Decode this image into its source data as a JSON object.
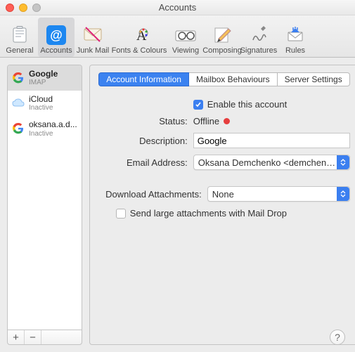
{
  "window": {
    "title": "Accounts"
  },
  "toolbar": {
    "items": [
      {
        "label": "General"
      },
      {
        "label": "Accounts"
      },
      {
        "label": "Junk Mail"
      },
      {
        "label": "Fonts & Colours"
      },
      {
        "label": "Viewing"
      },
      {
        "label": "Composing"
      },
      {
        "label": "Signatures"
      },
      {
        "label": "Rules"
      }
    ]
  },
  "sidebar": {
    "accounts": [
      {
        "name": "Google",
        "subtitle": "IMAP"
      },
      {
        "name": "iCloud",
        "subtitle": "Inactive"
      },
      {
        "name": "oksana.a.d...",
        "subtitle": "Inactive"
      }
    ],
    "add_label": "+",
    "remove_label": "−"
  },
  "tabs": {
    "items": [
      "Account Information",
      "Mailbox Behaviours",
      "Server Settings"
    ]
  },
  "form": {
    "enable_label": "Enable this account",
    "enable_checked": true,
    "status_label": "Status:",
    "status_value": "Offline",
    "description_label": "Description:",
    "description_value": "Google",
    "email_label": "Email Address:",
    "email_value": "Oksana Demchenko <demchen…",
    "download_label": "Download Attachments:",
    "download_value": "None",
    "maildrop_label": "Send large attachments with Mail Drop",
    "maildrop_checked": false
  },
  "help_label": "?"
}
